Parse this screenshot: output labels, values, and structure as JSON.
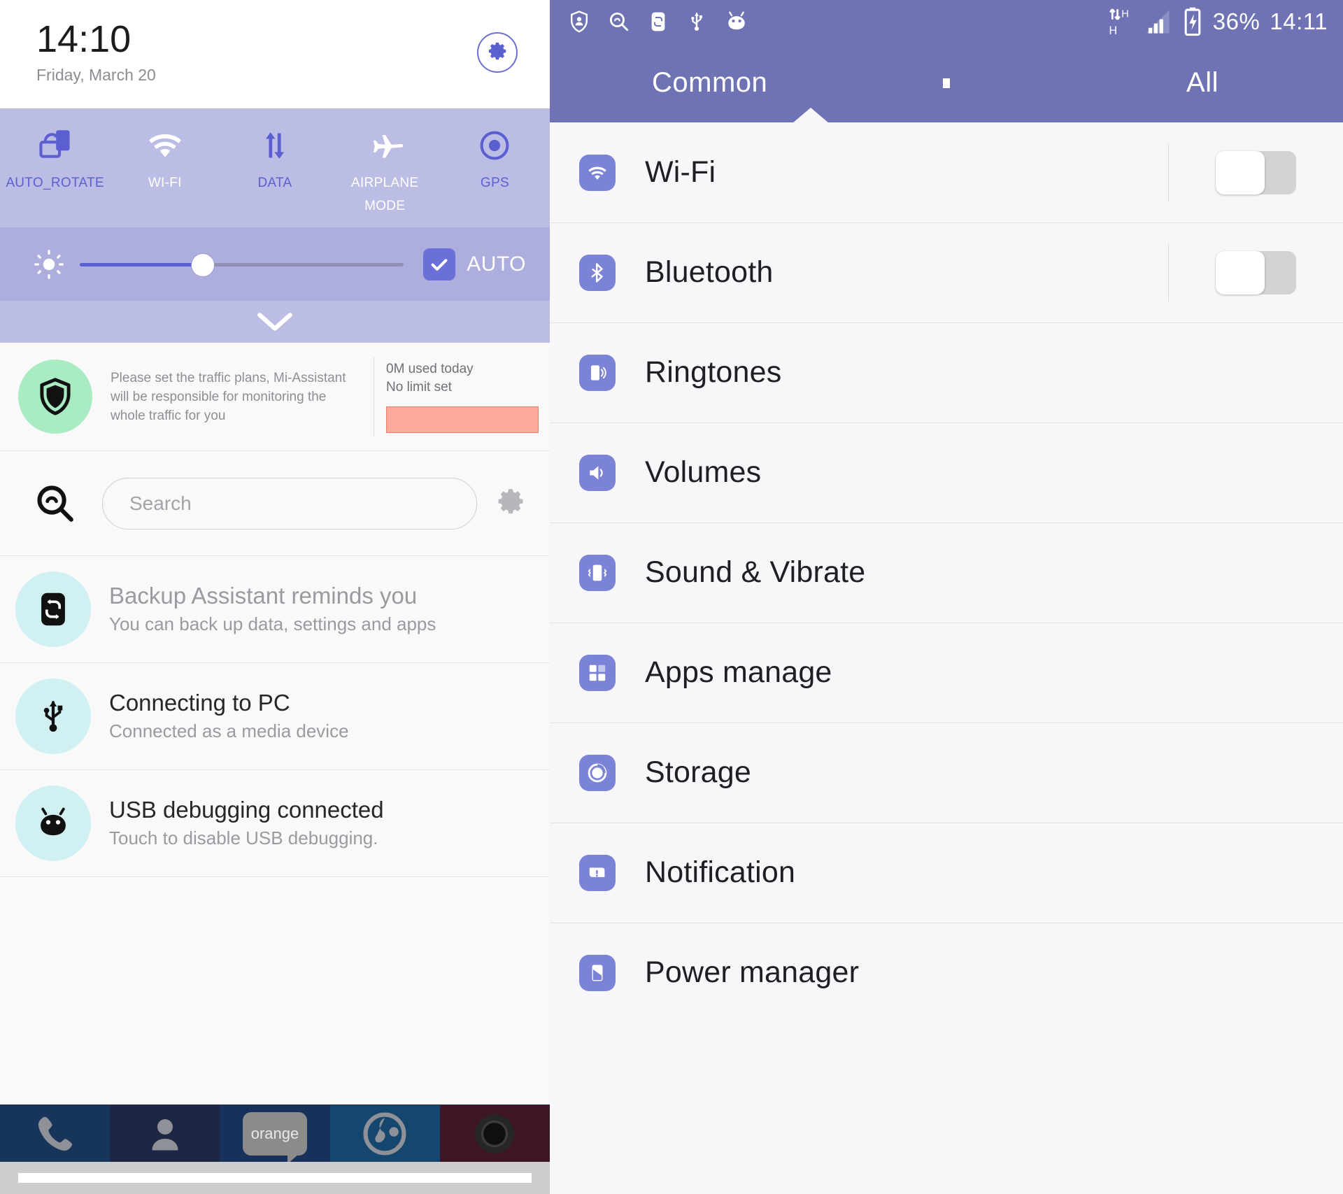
{
  "left": {
    "clock": {
      "time": "14:10",
      "date": "Friday, March 20",
      "settings_icon": "gear-icon"
    },
    "quick_toggles": [
      {
        "label": "AUTO_ROTATE",
        "icon": "auto-rotate-icon",
        "state": "on"
      },
      {
        "label": "WI-FI",
        "icon": "wifi-icon",
        "state": "off"
      },
      {
        "label": "DATA",
        "icon": "mobile-data-icon",
        "state": "on"
      },
      {
        "label": "AIRPLANE MODE",
        "icon": "airplane-icon",
        "state": "off"
      },
      {
        "label": "GPS",
        "icon": "gps-icon",
        "state": "on"
      }
    ],
    "brightness": {
      "icon": "brightness-icon",
      "value_percent": 38,
      "auto_label": "AUTO",
      "auto_checked": true
    },
    "expand": {
      "icon": "chevron-down-icon"
    },
    "traffic_card": {
      "icon": "shield-icon",
      "message": "Please set the traffic plans, Mi-Assistant will be responsible for monitoring the whole traffic for you",
      "used_today": "0M used today",
      "limit": "No limit set"
    },
    "search": {
      "icon": "search-icon",
      "placeholder": "Search",
      "value": "",
      "settings_icon": "gear-icon"
    },
    "notifications": [
      {
        "icon": "backup-icon",
        "title": "Backup Assistant reminds you",
        "subtitle": "You can back up data, settings and apps",
        "style": "muted"
      },
      {
        "icon": "usb-icon",
        "title": "Connecting to PC",
        "subtitle": "Connected as a media device",
        "style": "normal"
      },
      {
        "icon": "android-icon",
        "title": "USB debugging connected",
        "subtitle": "Touch to disable USB debugging.",
        "style": "normal"
      }
    ],
    "dock": [
      {
        "icon": "phone-icon",
        "label": ""
      },
      {
        "icon": "contacts-icon",
        "label": ""
      },
      {
        "icon": "messaging-icon",
        "label": "orange"
      },
      {
        "icon": "browser-icon",
        "label": ""
      },
      {
        "icon": "camera-icon",
        "label": ""
      }
    ]
  },
  "right": {
    "status_bar": {
      "left_icons": [
        "shield-person-icon",
        "search-icon",
        "backup-icon",
        "usb-icon",
        "android-icon"
      ],
      "right_icons": [
        "data-hsdpa-icon",
        "signal-bars-icon",
        "battery-charging-icon"
      ],
      "battery": "36%",
      "time": "14:11"
    },
    "tabs": [
      {
        "label": "Common",
        "active": true
      },
      {
        "label": "All",
        "active": false
      }
    ],
    "settings": [
      {
        "label": "Wi-Fi",
        "icon": "wifi-icon",
        "has_switch": true,
        "switch_on": false
      },
      {
        "label": "Bluetooth",
        "icon": "bluetooth-icon",
        "has_switch": true,
        "switch_on": false
      },
      {
        "label": "Ringtones",
        "icon": "ringtones-icon",
        "has_switch": false
      },
      {
        "label": "Volumes",
        "icon": "volume-icon",
        "has_switch": false
      },
      {
        "label": "Sound & Vibrate",
        "icon": "vibrate-icon",
        "has_switch": false
      },
      {
        "label": "Apps manage",
        "icon": "apps-grid-icon",
        "has_switch": false
      },
      {
        "label": "Storage",
        "icon": "storage-icon",
        "has_switch": false
      },
      {
        "label": "Notification",
        "icon": "notification-icon",
        "has_switch": false
      },
      {
        "label": "Power manager",
        "icon": "power-icon",
        "has_switch": false
      }
    ]
  },
  "colors": {
    "accent_purple": "#6b6fd8",
    "toggle_panel": "#bcbde4",
    "brightness_panel": "#adaedd",
    "status_bar": "#6f73b4",
    "icon_blue": "#7b83d6",
    "traffic_badge_green": "#a9ebc2",
    "notif_badge_cyan": "#d0f0f2",
    "traffic_bar_red": "#fbaa9b"
  }
}
